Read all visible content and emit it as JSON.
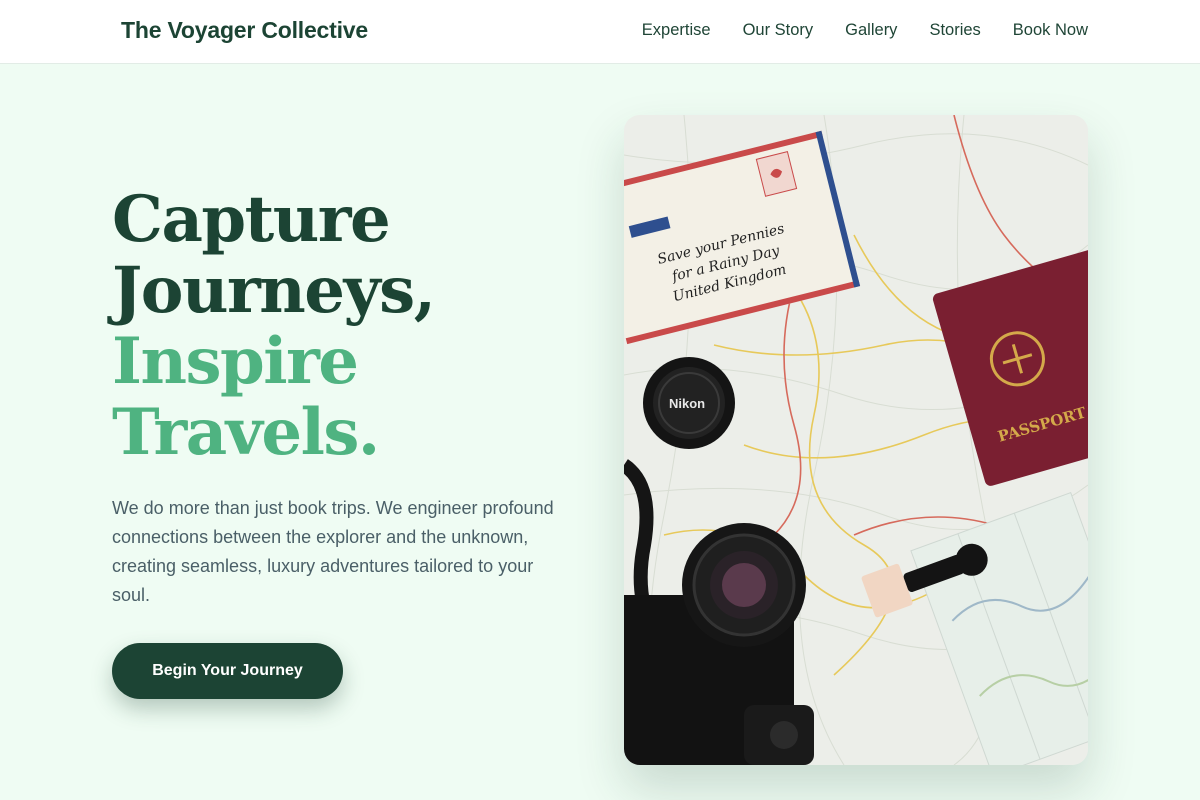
{
  "header": {
    "brand": "The Voyager Collective",
    "nav": [
      "Expertise",
      "Our Story",
      "Gallery",
      "Stories",
      "Book Now"
    ]
  },
  "hero": {
    "title_lines": [
      "Capture",
      "Journeys,",
      "Inspire",
      "Travels."
    ],
    "description": "We do more than just book trips. We engineer profound connections between the explorer and the unknown, creating seamless, luxury adventures tailored to your soul.",
    "cta_label": "Begin Your Journey",
    "image": {
      "envelope_text": [
        "Save your Pennies",
        "for a Rainy Day",
        "United Kingdom"
      ],
      "passport_text": "PASSPORT",
      "lens_cap_text": "Nikon"
    }
  },
  "colors": {
    "primary_dark": "#1c4434",
    "accent_green": "#4fb381",
    "page_background": "#effcf3",
    "body_text": "#4a5f67"
  }
}
